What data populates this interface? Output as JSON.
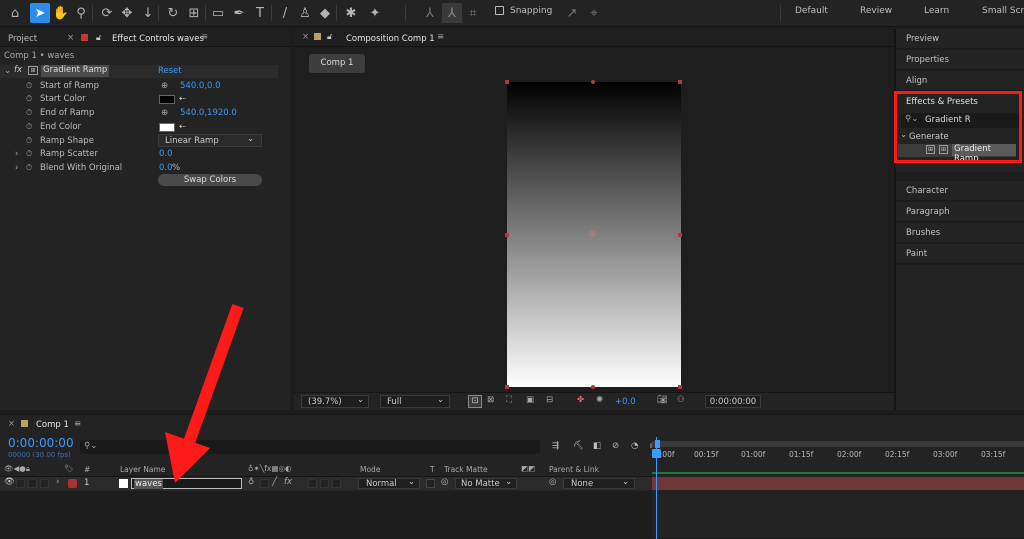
{
  "workspaces": [
    "Default",
    "Review",
    "Learn",
    "Small Scre"
  ],
  "toolbar": {
    "snapping": "Snapping"
  },
  "left_panel": {
    "tab_project": "Project",
    "tab_effect_controls": "Effect Controls waves",
    "breadcrumb": "Comp 1 • waves",
    "effect_name": "Gradient Ramp",
    "reset": "Reset",
    "props": [
      {
        "name": "Start of Ramp",
        "value": "540.0,0.0"
      },
      {
        "name": "Start Color",
        "value": ""
      },
      {
        "name": "End of Ramp",
        "value": "540.0,1920.0"
      },
      {
        "name": "End Color",
        "value": ""
      },
      {
        "name": "Ramp Shape",
        "value": "Linear Ramp"
      },
      {
        "name": "Ramp Scatter",
        "value": "0.0"
      },
      {
        "name": "Blend With Original",
        "value": "0.0",
        "unit": "%"
      }
    ],
    "swap_colors": "Swap Colors",
    "fx": "fx"
  },
  "comp_panel": {
    "tab": "Composition Comp 1",
    "tag": "Comp 1",
    "zoom": "(39.7%)",
    "resolution": "Full",
    "exposure": "+0.0",
    "timecode": "0:00:00:00"
  },
  "right_panel": {
    "items_top": [
      "Preview",
      "Properties",
      "Align"
    ],
    "effects_presets": "Effects & Presets",
    "search": "Gradient R",
    "category": "Generate",
    "result": "Gradient Ramp",
    "items_bottom": [
      "Character",
      "Paragraph",
      "Brushes",
      "Paint"
    ]
  },
  "timeline": {
    "tab": "Comp 1",
    "timecode": "0:00:00:00",
    "fps": "00000 (30.00 fps)",
    "columns": {
      "num": "#",
      "layer_name": "Layer Name",
      "mode": "Mode",
      "t": "T",
      "track_matte": "Track Matte",
      "parent": "Parent & Link"
    },
    "ruler": [
      "0:00f",
      "00:15f",
      "01:00f",
      "01:15f",
      "02:00f",
      "02:15f",
      "03:00f",
      "03:15f"
    ],
    "layer": {
      "num": "1",
      "name": "waves",
      "mode": "Normal",
      "matte": "No Matte",
      "parent": "None"
    }
  },
  "colors": {
    "accent": "#2d8ceb",
    "annotation": "#ff1a1a",
    "bar": "#6e3838"
  }
}
